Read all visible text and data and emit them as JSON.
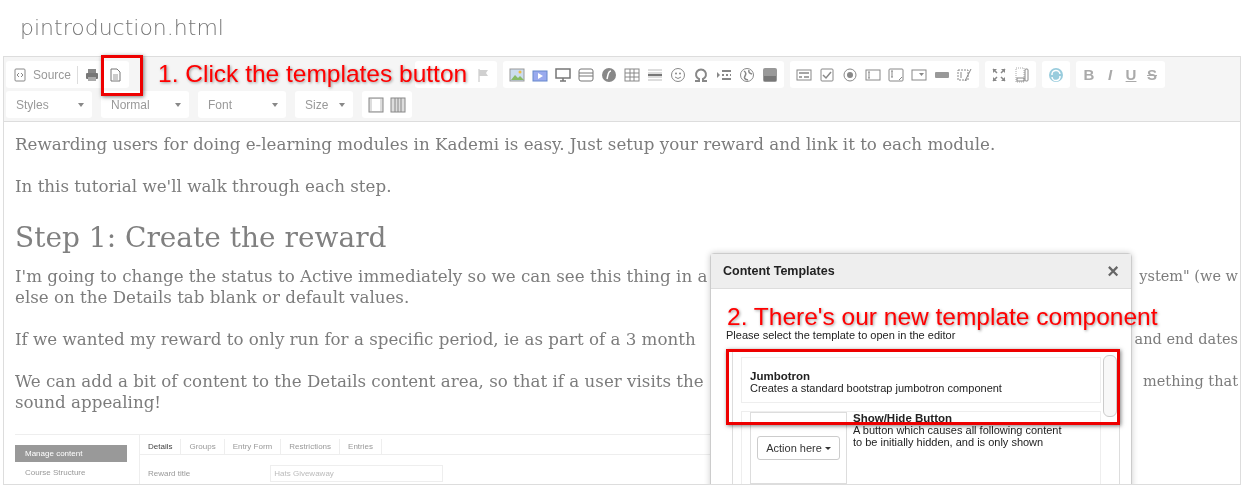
{
  "page_title": "pintroduction.html",
  "toolbar": {
    "source_label": "Source",
    "format_buttons": [
      "B",
      "I",
      "U",
      "S"
    ],
    "dropdowns": [
      {
        "label": "Styles"
      },
      {
        "label": "Normal"
      },
      {
        "label": "Font"
      },
      {
        "label": "Size"
      }
    ]
  },
  "content": {
    "blocks": [
      {
        "kind": "para",
        "lines": [
          {
            "left": "Rewarding users for doing e-learning modules in Kademi is easy. Just setup your reward and link it to each module."
          }
        ]
      },
      {
        "kind": "para",
        "lines": [
          {
            "left": "In this tutorial we'll walk through each step."
          }
        ]
      },
      {
        "kind": "heading",
        "lines": [
          {
            "left": "Step 1: Create the reward"
          }
        ]
      },
      {
        "kind": "para",
        "lines": [
          {
            "left": "I'm going to change the status to Active immediately so we can see this thing in a",
            "right": "ystem\" (we w"
          },
          {
            "left": "else on the Details tab blank or default values."
          }
        ]
      },
      {
        "kind": "para",
        "lines": [
          {
            "left": "If we wanted my reward to only run for a specific period, ie as part of a 3 month",
            "right": "and end dates"
          }
        ]
      },
      {
        "kind": "para",
        "lines": [
          {
            "left": "We can add a bit of content to the Details content area, so that if a user visits the",
            "right": "mething that"
          },
          {
            "left": "sound appealing!"
          }
        ]
      }
    ],
    "screenshot": {
      "sidebar_items": [
        {
          "label": "Manage content",
          "selected": true
        },
        {
          "label": "Course Structure",
          "selected": false
        }
      ],
      "tabs": [
        {
          "label": "Details",
          "selected": true
        },
        {
          "label": "Groups",
          "selected": false
        },
        {
          "label": "Entry Form",
          "selected": false
        },
        {
          "label": "Restrictions",
          "selected": false
        },
        {
          "label": "Entries",
          "selected": false
        }
      ],
      "field_label": "Reward title",
      "field_value": "Hats Givewaway"
    }
  },
  "dialog": {
    "title": "Content Templates",
    "close": "×",
    "instructions": "Please select the template to open in the editor",
    "templates": [
      {
        "kind": "text",
        "name": "Jumbotron",
        "description": "Creates a standard bootstrap jumbotron component"
      },
      {
        "kind": "preview",
        "name": "Show/Hide Button",
        "preview_button": "Action here",
        "description_lines": [
          "A button which causes all following content",
          "to be initially hidden, and is only shown"
        ]
      }
    ]
  },
  "annotations": [
    {
      "text": "1. Click the templates button"
    },
    {
      "text": "2. There's our new template component"
    }
  ]
}
